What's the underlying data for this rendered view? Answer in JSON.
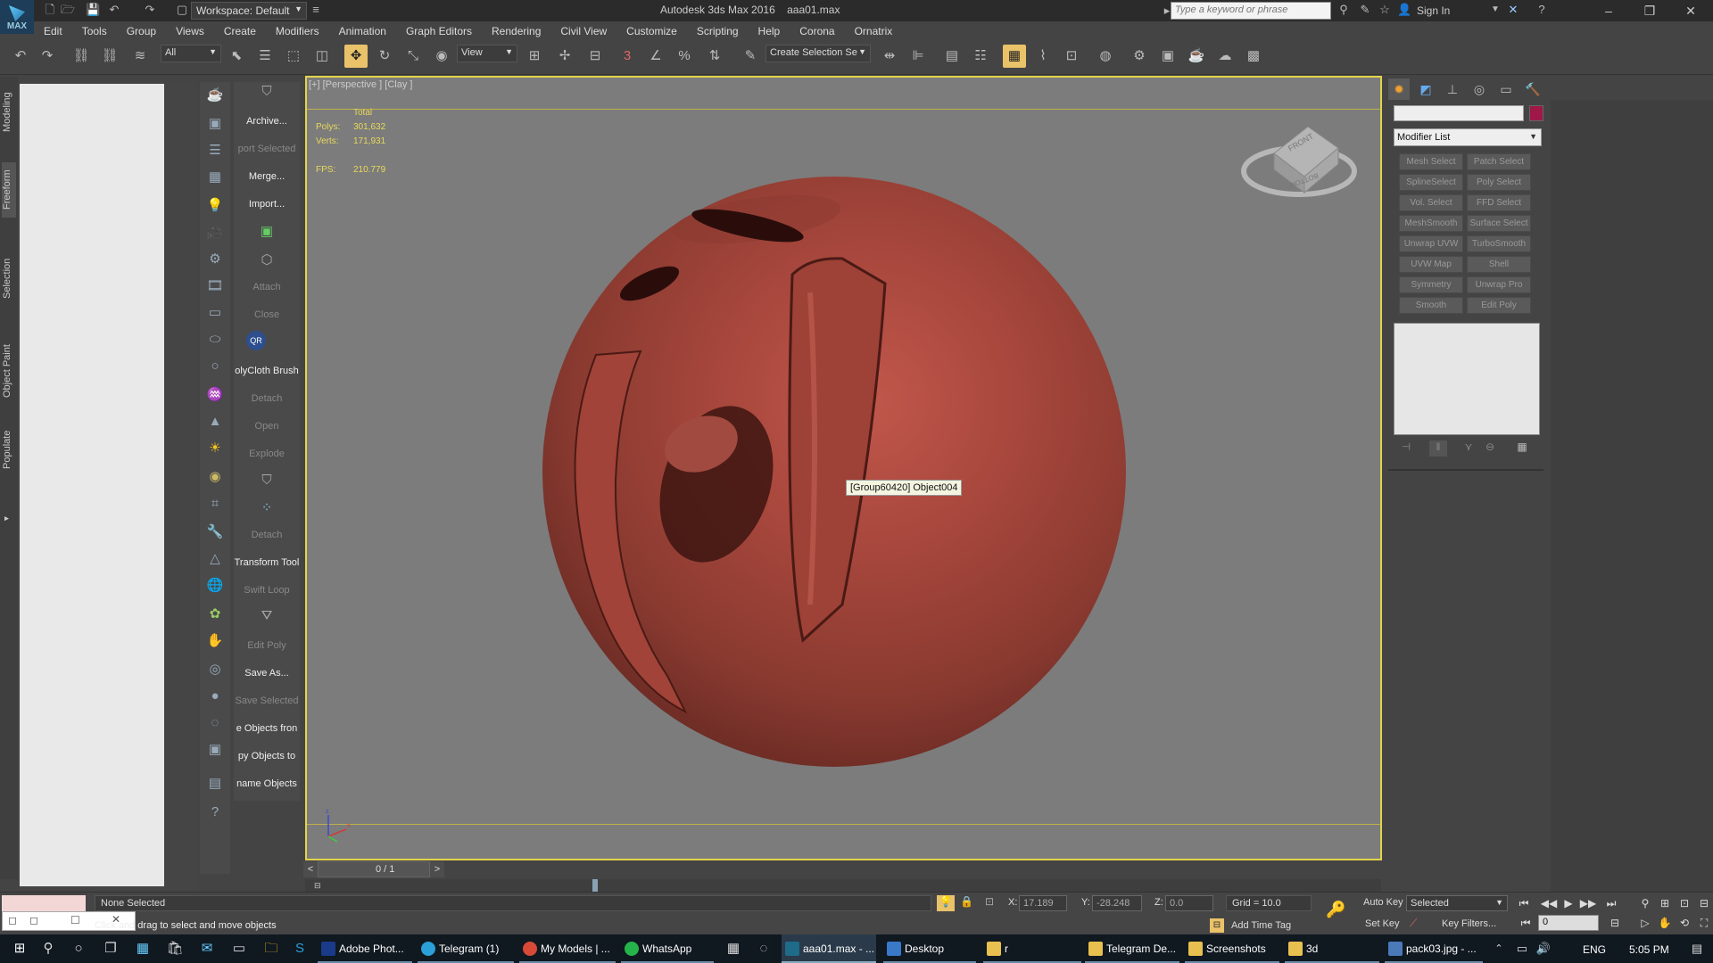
{
  "app": {
    "logo_text": "MAX",
    "title": "Autodesk 3ds Max 2016",
    "file_name": "aaa01.max",
    "workspace": "Workspace: Default",
    "search_placeholder": "Type a keyword or phrase",
    "sign_in": "Sign In"
  },
  "menu": [
    "Edit",
    "Tools",
    "Group",
    "Views",
    "Create",
    "Modifiers",
    "Animation",
    "Graph Editors",
    "Rendering",
    "Civil View",
    "Customize",
    "Scripting",
    "Help",
    "Corona",
    "Ornatrix"
  ],
  "toolbar": {
    "selection_filter": "All",
    "ref_coord": "View",
    "named_selection": "Create Selection Se",
    "snap_label": "3"
  },
  "ribbon_tabs": [
    "Modeling",
    "Freeform",
    "Selection",
    "Object Paint",
    "Populate"
  ],
  "scripts_panel": {
    "labels": [
      {
        "text": "Archive...",
        "dim": false
      },
      {
        "text": "port Selected",
        "dim": true
      },
      {
        "text": "Merge...",
        "dim": false
      },
      {
        "text": "Import...",
        "dim": false
      },
      {
        "text": "Attach",
        "dim": true
      },
      {
        "text": "Close",
        "dim": true
      },
      {
        "text": "olyCloth Brush",
        "dim": false
      },
      {
        "text": "Detach",
        "dim": true
      },
      {
        "text": "Open",
        "dim": true
      },
      {
        "text": "Explode",
        "dim": true
      },
      {
        "text": "Detach",
        "dim": true
      },
      {
        "text": "Transform Tool",
        "dim": false
      },
      {
        "text": "Swift Loop",
        "dim": true
      },
      {
        "text": "Edit Poly",
        "dim": true
      },
      {
        "text": "Save As...",
        "dim": false
      },
      {
        "text": "Save Selected",
        "dim": true
      },
      {
        "text": "e Objects fron",
        "dim": false
      },
      {
        "text": "py Objects to",
        "dim": false
      },
      {
        "text": "name Objects",
        "dim": false
      }
    ],
    "qr_badge": "QR"
  },
  "viewport": {
    "label": "[+] [Perspective ] [Clay ]",
    "stats_header": "Total",
    "polys_label": "Polys:",
    "polys": "301,632",
    "verts_label": "Verts:",
    "verts": "171,931",
    "fps_label": "FPS:",
    "fps": "210.779",
    "tooltip": "[Group60420] Object004",
    "viewcube_front": "FRONT",
    "viewcube_bottom": "BOTTOM",
    "axis_x": "x",
    "axis_z": "z"
  },
  "timeline": {
    "frame_display": "0 / 1",
    "prev": "<",
    "next": ">"
  },
  "command_panel": {
    "modifier_list": "Modifier List",
    "modifier_buttons": [
      "Mesh Select",
      "Patch Select",
      "SplineSelect",
      "Poly Select",
      "Vol. Select",
      "FFD Select",
      "MeshSmooth",
      "Surface Select",
      "Unwrap UVW",
      "TurboSmooth",
      "UVW Map",
      "Shell",
      "Symmetry",
      "Unwrap Pro",
      "Smooth",
      "Edit Poly"
    ],
    "object_color": "#a01848"
  },
  "status": {
    "selection": "None Selected",
    "prompt": "Click and drag to select and move objects",
    "x_label": "X:",
    "x": "17.189",
    "y_label": "Y:",
    "y": "-28.248",
    "z_label": "Z:",
    "z": "0.0",
    "grid": "Grid = 10.0",
    "add_time_tag": "Add Time Tag",
    "auto_key": "Auto Key",
    "set_key": "Set Key",
    "key_mode": "Selected",
    "key_filters": "Key Filters...",
    "current_frame": "0"
  },
  "taskbar": {
    "apps": [
      {
        "label": "Adobe Phot...",
        "color": "#1a3a8a",
        "state": "open"
      },
      {
        "label": "Telegram (1)",
        "color": "#2a9fd8",
        "state": "open"
      },
      {
        "label": "My Models | ...",
        "color": "#d84a38",
        "state": "open"
      },
      {
        "label": "WhatsApp",
        "color": "#25b449",
        "state": "open"
      },
      {
        "label": "aaa01.max - ...",
        "color": "#1e6b8a",
        "state": "active"
      },
      {
        "label": "Desktop",
        "color": "#3a78c8",
        "state": "open"
      },
      {
        "label": "r",
        "color": "#e8c050",
        "state": "open"
      },
      {
        "label": "Telegram De...",
        "color": "#e8c050",
        "state": "open"
      },
      {
        "label": "Screenshots",
        "color": "#e8c050",
        "state": "open"
      },
      {
        "label": "3d",
        "color": "#e8c050",
        "state": "open"
      },
      {
        "label": "pack03.jpg - ...",
        "color": "#4a7ab8",
        "state": "open"
      }
    ],
    "language": "ENG",
    "time": "5:05 PM"
  }
}
